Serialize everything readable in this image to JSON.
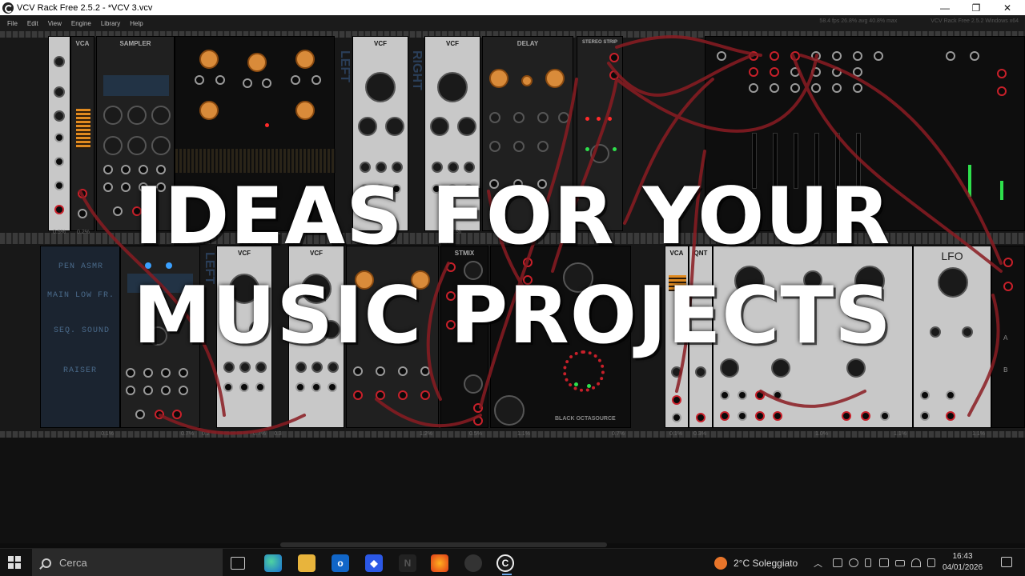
{
  "window": {
    "title": "VCV Rack Free 2.5.2 - *VCV 3.vcv",
    "minimize": "—",
    "maximize": "❐",
    "close": "✕"
  },
  "menu": {
    "items": [
      "File",
      "Edit",
      "View",
      "Engine",
      "Library",
      "Help"
    ],
    "stats": "58.4 fps  26.8% avg  40.8% max",
    "version": "VCV Rack Free 2.5.2 Windows x64"
  },
  "rack": {
    "top_modules": {
      "vca": "VCA",
      "sampler": "SAMPLER",
      "vcf1": "VCF",
      "vcf2": "VCF",
      "delay": "DELAY",
      "stereo_strip": "STEREO STRIP",
      "left": "LEFT",
      "right": "RIGHT"
    },
    "bottom_modules": {
      "vcf1": "VCF",
      "vcf2": "VCF",
      "stmix": "STMIX",
      "vca": "VCA",
      "qnt": "QNT",
      "lfo": "LFO",
      "octasource": "BLACK OCTASOURCE",
      "left": "LEFT"
    },
    "notes": [
      "PEN ASMR",
      "MAIN LOW FR.",
      "SEQ. SOUND",
      "RAISER"
    ],
    "cpu_top": [
      "0.5%",
      "0.2%",
      "0.9%"
    ],
    "cpu_bottom": [
      "0.1%",
      "0.7%",
      "0.2",
      "0.7%",
      "0.3",
      "1.2%",
      "0.5%",
      "1.1%",
      "0.7%",
      "0.1%",
      "0.3%",
      "1.0%",
      "1.1%",
      "1.1%"
    ]
  },
  "headline": {
    "line1": "IDEAS FOR YOUR",
    "line2": "MUSIC PROJECTS"
  },
  "taskbar": {
    "search_placeholder": "Cerca",
    "weather": "2°C  Soleggiato",
    "time": "16:43",
    "date": "04/01/2026"
  },
  "colors": {
    "cable": "#8a1c22",
    "headline": "#ffffff",
    "titlebar": "#ffffff",
    "taskbar": "#121212"
  }
}
